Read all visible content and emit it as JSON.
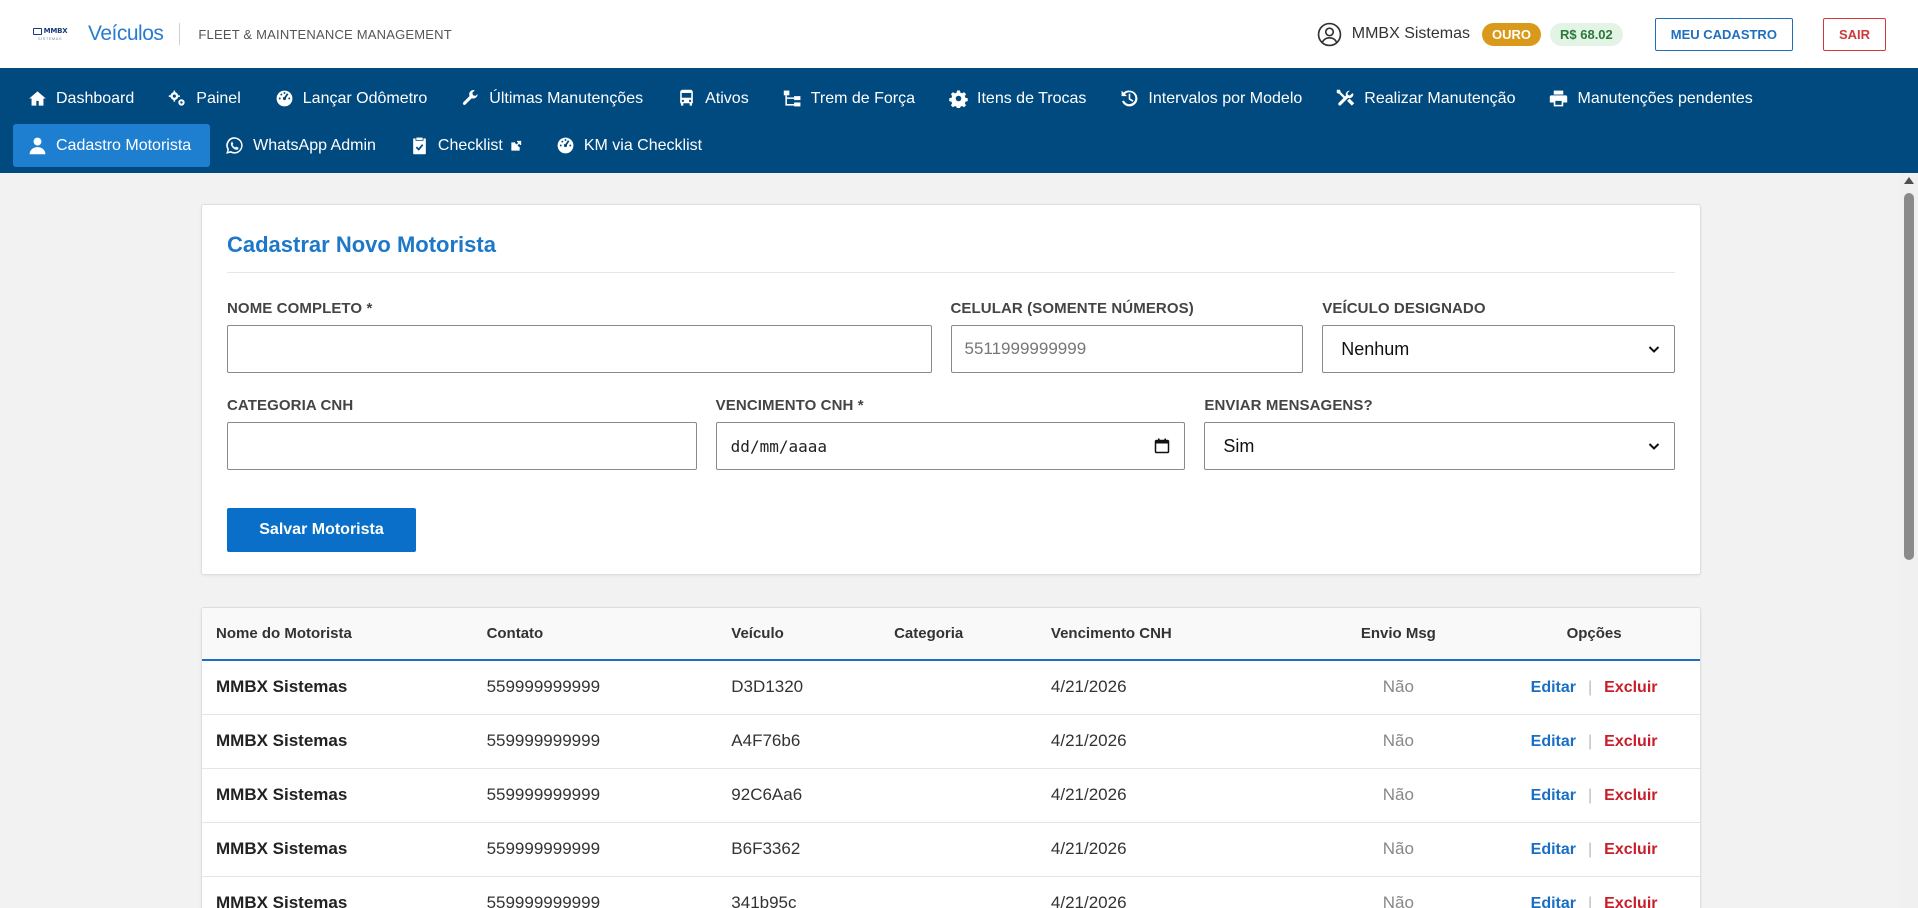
{
  "header": {
    "logo_text": "MMBX",
    "logo_sub": "SISTEMAS",
    "app_title": "Veículos",
    "subtitle": "FLEET & MAINTENANCE MANAGEMENT",
    "user_name": "MMBX Sistemas",
    "plan_badge": "OURO",
    "balance": "R$ 68.02",
    "profile_button": "MEU CADASTRO",
    "logout_button": "SAIR"
  },
  "nav": {
    "row1": [
      {
        "label": "Dashboard",
        "icon": "home-icon"
      },
      {
        "label": "Painel",
        "icon": "gears-icon"
      },
      {
        "label": "Lançar Odômetro",
        "icon": "gauge-icon"
      },
      {
        "label": "Últimas Manutenções",
        "icon": "wrench-icon"
      },
      {
        "label": "Ativos",
        "icon": "bus-icon"
      },
      {
        "label": "Trem de Força",
        "icon": "sitemap-icon"
      },
      {
        "label": "Itens de Trocas",
        "icon": "gear-icon"
      },
      {
        "label": "Intervalos por Modelo",
        "icon": "history-icon"
      },
      {
        "label": "Realizar Manutenção",
        "icon": "tools-icon"
      },
      {
        "label": "Manutenções pendentes",
        "icon": "printer-icon"
      }
    ],
    "row2": [
      {
        "label": "Cadastro Motorista",
        "icon": "user-icon",
        "active": true
      },
      {
        "label": "WhatsApp Admin",
        "icon": "whatsapp-icon"
      },
      {
        "label": "Checklist",
        "icon": "clipboard-check-icon"
      },
      {
        "label": "KM via Checklist",
        "icon": "gauge-icon"
      }
    ]
  },
  "form": {
    "title": "Cadastrar Novo Motorista",
    "name_label": "NOME COMPLETO *",
    "name_value": "",
    "phone_label": "CELULAR (SOMENTE NÚMEROS)",
    "phone_placeholder": "5511999999999",
    "vehicle_label": "VEÍCULO DESIGNADO",
    "vehicle_selected": "Nenhum",
    "category_label": "CATEGORIA CNH",
    "category_value": "",
    "expiry_label": "VENCIMENTO CNH *",
    "expiry_placeholder": "dd/mm/aaaa",
    "messages_label": "ENVIAR MENSAGENS?",
    "messages_selected": "Sim",
    "save_button": "Salvar Motorista"
  },
  "table": {
    "columns": [
      "Nome do Motorista",
      "Contato",
      "Veículo",
      "Categoria",
      "Vencimento CNH",
      "Envio Msg",
      "Opções"
    ],
    "edit_label": "Editar",
    "delete_label": "Excluir",
    "separator": "|",
    "rows": [
      {
        "name": "MMBX Sistemas",
        "contact": "559999999999",
        "vehicle": "D3D1320",
        "category": "",
        "expiry": "4/21/2026",
        "send_msg": "Não"
      },
      {
        "name": "MMBX Sistemas",
        "contact": "559999999999",
        "vehicle": "A4F76b6",
        "category": "",
        "expiry": "4/21/2026",
        "send_msg": "Não"
      },
      {
        "name": "MMBX Sistemas",
        "contact": "559999999999",
        "vehicle": "92C6Aa6",
        "category": "",
        "expiry": "4/21/2026",
        "send_msg": "Não"
      },
      {
        "name": "MMBX Sistemas",
        "contact": "559999999999",
        "vehicle": "B6F3362",
        "category": "",
        "expiry": "4/21/2026",
        "send_msg": "Não"
      },
      {
        "name": "MMBX Sistemas",
        "contact": "559999999999",
        "vehicle": "341b95c",
        "category": "",
        "expiry": "4/21/2026",
        "send_msg": "Não"
      }
    ]
  }
}
